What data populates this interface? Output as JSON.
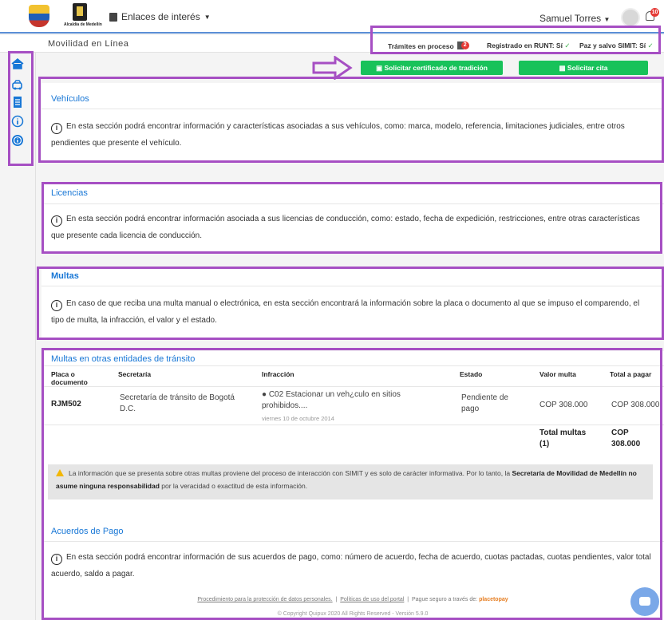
{
  "header": {
    "logo_text": "Alcaldía de Medellín",
    "enlaces_label": "Enlaces de interés",
    "user_name": "Samuel Torres",
    "notification_count": "10"
  },
  "subbar": {
    "title": "Movilidad en Línea",
    "tramites_label": "Trámites en proceso",
    "tramites_badge": "2",
    "runt_label": "Registrado en RUNT: Sí",
    "simit_label": "Paz y salvo SIMIT: Sí"
  },
  "actions": {
    "certificado_label": "Solicitar certificado de tradición",
    "cita_label": "Solicitar cita",
    "accent_color": "#18c25a"
  },
  "sidebar": {
    "icons": [
      "home-icon",
      "car-icon",
      "document-icon",
      "info-outline-icon",
      "info-filled-icon"
    ]
  },
  "sections": {
    "vehiculos": {
      "title": "Vehículos",
      "text": "En esta sección podrá encontrar información y características asociadas a sus vehículos, como: marca, modelo, referencia, limitaciones judiciales, entre otros pendientes que presente el vehículo."
    },
    "licencias": {
      "title": "Licencias",
      "text": "En esta sección podrá encontrar información asociada a sus licencias de conducción, como: estado, fecha de expedición, restricciones, entre otras características que presente cada licencia de conducción."
    },
    "multas": {
      "title": "Multas",
      "text": "En caso de que reciba una multa manual o electrónica, en esta sección encontrará la información sobre la placa o documento al que se impuso el comparendo, el tipo de multa, la infracción, el valor y el estado."
    },
    "otras": {
      "title": "Multas en otras entidades de tránsito",
      "columns": [
        "Placa o documento",
        "Secretaría",
        "Infracción",
        "Estado",
        "Valor multa",
        "Total a pagar"
      ],
      "row": {
        "placa": "RJM502",
        "secretaria": "Secretaría de tránsito de Bogotá D.C.",
        "infraccion": "C02 Estacionar un veh¿culo en sitios prohibidos....",
        "fecha": "viernes 10 de octubre 2014",
        "estado": "Pendiente de pago",
        "valor": "COP 308.000",
        "total": "COP 308.000"
      },
      "total_label": "Total multas (1)",
      "total_value": "COP 308.000",
      "warning_pre": "La información que se presenta sobre otras multas proviene del proceso de interacción con SIMIT y es solo de carácter informativa. Por lo tanto, la",
      "warning_bold": "Secretaría de Movilidad de Medellín no asume ninguna responsabilidad",
      "warning_post": "por la veracidad o exactitud de esta información."
    },
    "acuerdos": {
      "title": "Acuerdos de Pago",
      "text": "En esta sección podrá encontrar información de sus acuerdos de pago, como: número de acuerdo, fecha de acuerdo, cuotas pactadas, cuotas pendientes, valor total acuerdo, saldo a pagar."
    }
  },
  "footer": {
    "link1": "Procedimiento para la protección de datos personales.",
    "link2": "Políticas de uso del portal",
    "pay_text": "Pague seguro a través de:",
    "pay_brand": "placetopay",
    "copyright": "© Copyright Quipux 2020 All Rights Reserved - Versión 5.9.0"
  }
}
